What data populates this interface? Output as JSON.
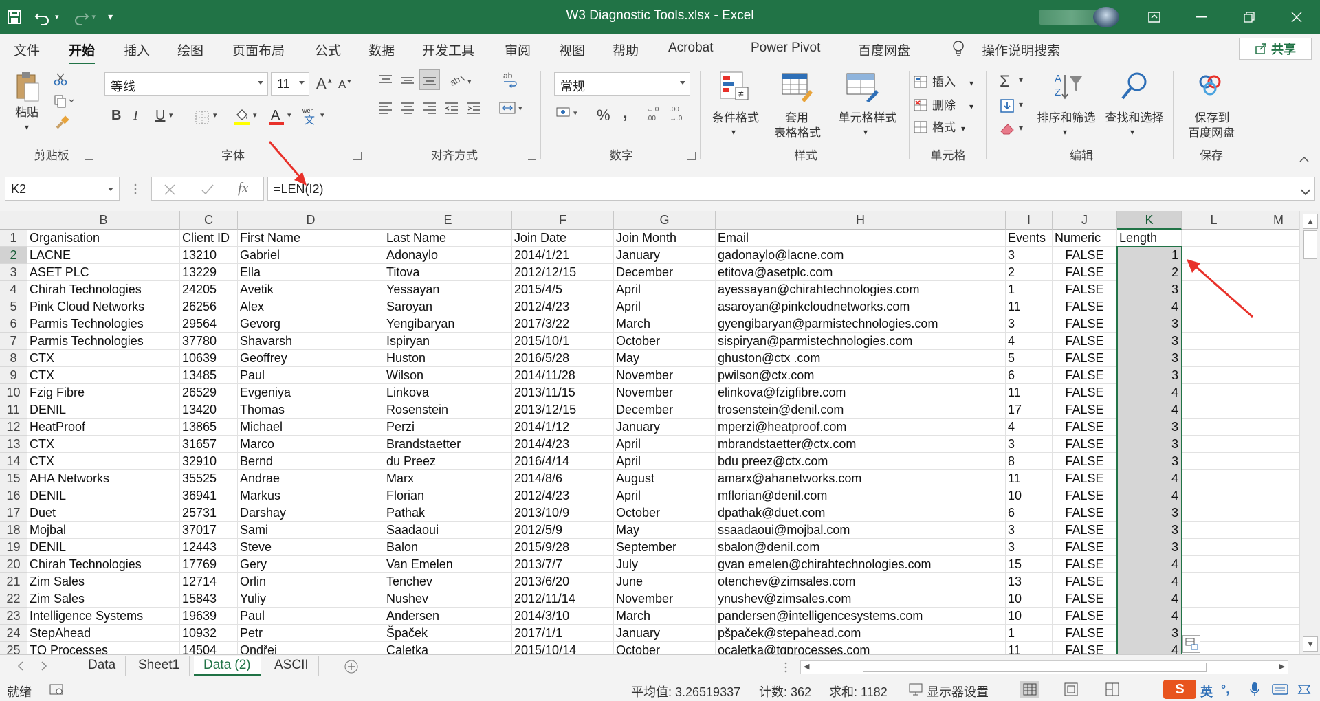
{
  "window": {
    "title": "W3 Diagnostic Tools.xlsx  -  Excel"
  },
  "menu": {
    "tabs": [
      "文件",
      "开始",
      "插入",
      "绘图",
      "页面布局",
      "公式",
      "数据",
      "开发工具",
      "审阅",
      "视图",
      "帮助",
      "Acrobat",
      "Power Pivot",
      "百度网盘"
    ],
    "active": "开始",
    "tell_me": "操作说明搜索",
    "share": "共享"
  },
  "ribbon": {
    "clipboard": {
      "paste": "粘贴",
      "label": "剪贴板"
    },
    "font": {
      "name": "等线",
      "size": "11",
      "label": "字体",
      "bold": "B",
      "italic": "I",
      "underline": "U",
      "grow": "A",
      "shrink": "A",
      "phonetic": "wén"
    },
    "alignment": {
      "label": "对齐方式"
    },
    "number": {
      "format": "常规",
      "label": "数字",
      "percent": "%",
      "comma": ","
    },
    "styles": {
      "conditional": "条件格式",
      "table_line1": "套用",
      "table_line2": "表格格式",
      "cell_styles": "单元格样式",
      "label": "样式"
    },
    "cells": {
      "insert": "插入",
      "delete": "删除",
      "format": "格式",
      "label": "单元格"
    },
    "editing": {
      "sort": "排序和筛选",
      "find": "查找和选择",
      "label": "编辑"
    },
    "save": {
      "line1": "保存到",
      "line2": "百度网盘",
      "label": "保存"
    }
  },
  "formula_bar": {
    "name_box": "K2",
    "fx": "fx",
    "formula": "=LEN(I2)"
  },
  "sheet": {
    "columns": [
      {
        "id": "B"
      },
      {
        "id": "C"
      },
      {
        "id": "D"
      },
      {
        "id": "E"
      },
      {
        "id": "F"
      },
      {
        "id": "G"
      },
      {
        "id": "H"
      },
      {
        "id": "I"
      },
      {
        "id": "J"
      },
      {
        "id": "K"
      },
      {
        "id": "L"
      },
      {
        "id": "M"
      }
    ],
    "selected_column": "K",
    "rows": [
      {
        "n": "1",
        "cells": [
          "Organisation",
          "Client ID",
          "First Name",
          "Last Name",
          "Join Date",
          "Join Month",
          "Email",
          "Events",
          "Numeric",
          "Length"
        ]
      },
      {
        "n": "2",
        "cells": [
          "LACNE",
          "13210",
          "Gabriel",
          "Adonaylo",
          "2014/1/21",
          "January",
          "gadonaylo@lacne.com",
          "3",
          "FALSE",
          "1"
        ]
      },
      {
        "n": "3",
        "cells": [
          "ASET PLC",
          "13229",
          "Ella",
          "Titova",
          "2012/12/15",
          "December",
          "etitova@asetplc.com",
          "2",
          "FALSE",
          "2"
        ]
      },
      {
        "n": "4",
        "cells": [
          "Chirah Technologies",
          "24205",
          "Avetik",
          "Yessayan",
          "2015/4/5",
          "April",
          "ayessayan@chirahtechnologies.com",
          "1",
          "FALSE",
          "3"
        ]
      },
      {
        "n": "5",
        "cells": [
          "Pink Cloud Networks",
          "26256",
          "Alex",
          "Saroyan",
          "2012/4/23",
          "April",
          "asaroyan@pinkcloudnetworks.com",
          "11",
          "FALSE",
          "4"
        ]
      },
      {
        "n": "6",
        "cells": [
          "Parmis Technologies",
          "29564",
          "Gevorg",
          "Yengibaryan",
          "2017/3/22",
          "March",
          "gyengibaryan@parmistechnologies.com",
          "3",
          "FALSE",
          "3"
        ]
      },
      {
        "n": "7",
        "cells": [
          "Parmis Technologies",
          "37780",
          "Shavarsh",
          "Ispiryan",
          "2015/10/1",
          "October",
          "sispiryan@parmistechnologies.com",
          "4",
          "FALSE",
          "3"
        ]
      },
      {
        "n": "8",
        "cells": [
          "CTX",
          "10639",
          "Geoffrey",
          "Huston",
          "2016/5/28",
          "May",
          "ghuston@ctx .com",
          "5",
          "FALSE",
          "3"
        ]
      },
      {
        "n": "9",
        "cells": [
          "CTX",
          "13485",
          "Paul",
          "Wilson",
          "2014/11/28",
          "November",
          "pwilson@ctx.com",
          "6",
          "FALSE",
          "3"
        ]
      },
      {
        "n": "10",
        "cells": [
          "Fzig Fibre",
          "26529",
          "Evgeniya",
          "Linkova",
          "2013/11/15",
          "November",
          "elinkova@fzigfibre.com",
          "11",
          "FALSE",
          "4"
        ]
      },
      {
        "n": "11",
        "cells": [
          "DENIL",
          "13420",
          "Thomas",
          "Rosenstein",
          "2013/12/15",
          "December",
          "trosenstein@denil.com",
          "17",
          "FALSE",
          "4"
        ]
      },
      {
        "n": "12",
        "cells": [
          "HeatProof",
          "13865",
          "Michael",
          "Perzi",
          "2014/1/12",
          "January",
          "mperzi@heatproof.com",
          "4",
          "FALSE",
          "3"
        ]
      },
      {
        "n": "13",
        "cells": [
          "CTX",
          "31657",
          "Marco",
          "Brandstaetter",
          "2014/4/23",
          "April",
          "mbrandstaetter@ctx.com",
          "3",
          "FALSE",
          "3"
        ]
      },
      {
        "n": "14",
        "cells": [
          "CTX",
          "32910",
          "Bernd",
          "du Preez",
          "2016/4/14",
          "April",
          "bdu preez@ctx.com",
          "8",
          "FALSE",
          "3"
        ]
      },
      {
        "n": "15",
        "cells": [
          "AHA Networks",
          "35525",
          "Andrae",
          "Marx",
          "2014/8/6",
          "August",
          "amarx@ahanetworks.com",
          "11",
          "FALSE",
          "4"
        ]
      },
      {
        "n": "16",
        "cells": [
          "DENIL",
          "36941",
          "Markus",
          "Florian",
          "2012/4/23",
          "April",
          "mflorian@denil.com",
          "10",
          "FALSE",
          "4"
        ]
      },
      {
        "n": "17",
        "cells": [
          "Duet",
          "25731",
          "Darshay",
          "Pathak",
          "2013/10/9",
          "October",
          "dpathak@duet.com",
          "6",
          "FALSE",
          "3"
        ]
      },
      {
        "n": "18",
        "cells": [
          "Mojbal",
          "37017",
          "Sami",
          "Saadaoui",
          "2012/5/9",
          "May",
          "ssaadaoui@mojbal.com",
          "3",
          "FALSE",
          "3"
        ]
      },
      {
        "n": "19",
        "cells": [
          "DENIL",
          "12443",
          "Steve",
          "Balon",
          "2015/9/28",
          "September",
          "sbalon@denil.com",
          "3",
          "FALSE",
          "3"
        ]
      },
      {
        "n": "20",
        "cells": [
          "Chirah Technologies",
          "17769",
          "Gery",
          "Van Emelen",
          "2013/7/7",
          "July",
          "gvan emelen@chirahtechnologies.com",
          "15",
          "FALSE",
          "4"
        ]
      },
      {
        "n": "21",
        "cells": [
          "Zim Sales",
          "12714",
          "Orlin",
          "Tenchev",
          "2013/6/20",
          "June",
          "otenchev@zimsales.com",
          "13",
          "FALSE",
          "4"
        ]
      },
      {
        "n": "22",
        "cells": [
          "Zim Sales",
          "15843",
          "Yuliy",
          "Nushev",
          "2012/11/14",
          "November",
          "ynushev@zimsales.com",
          "10",
          "FALSE",
          "4"
        ]
      },
      {
        "n": "23",
        "cells": [
          "Intelligence Systems",
          "19639",
          "Paul",
          "Andersen",
          "2014/3/10",
          "March",
          "pandersen@intelligencesystems.com",
          "10",
          "FALSE",
          "4"
        ]
      },
      {
        "n": "24",
        "cells": [
          "StepAhead",
          "10932",
          "Petr",
          "Špaček",
          "2017/1/1",
          "January",
          "pšpaček@stepahead.com",
          "1",
          "FALSE",
          "3"
        ]
      },
      {
        "n": "25",
        "cells": [
          "TQ Processes",
          "14504",
          "Ondřej",
          "Caletka",
          "2015/10/14",
          "October",
          "ocaletka@tqprocesses.com",
          "11",
          "FALSE",
          "4"
        ]
      }
    ]
  },
  "sheet_tabs": [
    "Data",
    "Sheet1",
    "Data (2)",
    "ASCII"
  ],
  "active_sheet": "Data (2)",
  "status": {
    "mode": "就绪",
    "average": "平均值: 3.26519337",
    "count": "计数: 362",
    "sum": "求和: 1182",
    "display": "显示器设置",
    "ime": "英"
  },
  "colors": {
    "excel_green": "#217346",
    "annotation_red": "#e8312a"
  }
}
